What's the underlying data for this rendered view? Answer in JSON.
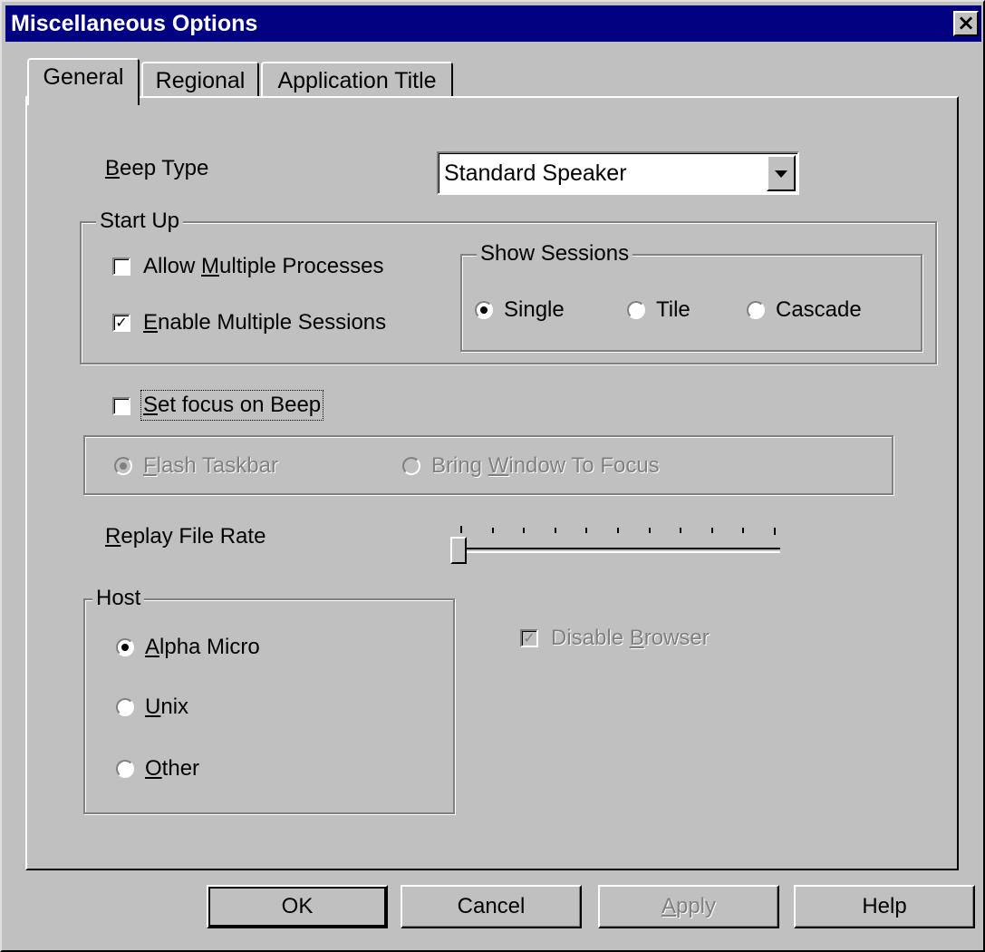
{
  "window": {
    "title": "Miscellaneous Options",
    "close_icon": "×"
  },
  "tabs": [
    {
      "label": "General",
      "active": true
    },
    {
      "label": "Regional",
      "active": false
    },
    {
      "label": "Application Title",
      "active": false
    }
  ],
  "beep": {
    "label_key": "B",
    "label_rest": "eep Type",
    "selected": "Standard Speaker"
  },
  "startup": {
    "legend": "Start Up",
    "allow_multiple": {
      "pre": "Allow ",
      "key": "M",
      "post": "ultiple Processes",
      "checked": false
    },
    "enable_multiple": {
      "pre": "",
      "key": "E",
      "post": "nable Multiple Sessions",
      "checked": true
    },
    "show_sessions": {
      "legend": "Show Sessions",
      "options": [
        "Single",
        "Tile",
        "Cascade"
      ],
      "selected": "Single"
    }
  },
  "focus_beep": {
    "key": "S",
    "rest": "et focus on Beep",
    "checked": false,
    "options": {
      "flash": {
        "key": "F",
        "rest": "lash Taskbar",
        "selected": true
      },
      "bring": {
        "pre": "Bring ",
        "key": "W",
        "post": "indow To Focus",
        "selected": false
      }
    }
  },
  "replay": {
    "key": "R",
    "rest": "eplay File Rate",
    "value_fraction": 0.0,
    "tick_count": 11
  },
  "host": {
    "legend": "Host",
    "options": [
      {
        "key": "A",
        "rest": "lpha Micro",
        "selected": true
      },
      {
        "key": "U",
        "rest": "nix",
        "selected": false
      },
      {
        "key": "O",
        "rest": "ther",
        "selected": false
      }
    ]
  },
  "disable_browser": {
    "pre": "Disable ",
    "key": "B",
    "post": "rowser",
    "checked": true
  },
  "buttons": {
    "ok": "OK",
    "cancel": "Cancel",
    "apply_key": "A",
    "apply_rest": "pply",
    "help": "Help"
  },
  "colors": {
    "title_bar": "#000080",
    "face": "#c0c0c0",
    "disabled_text": "#808080"
  }
}
